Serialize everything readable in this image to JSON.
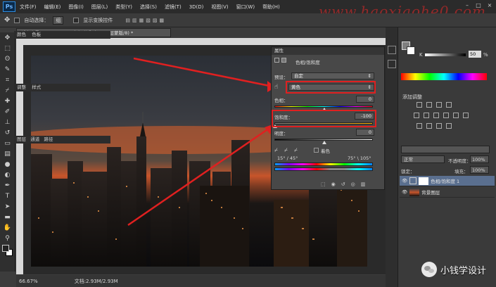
{
  "menubar": {
    "logo": "Ps",
    "items": [
      "文件(F)",
      "编辑(E)",
      "图像(I)",
      "图层(L)",
      "类型(Y)",
      "选择(S)",
      "滤镜(T)",
      "3D(D)",
      "视图(V)",
      "窗口(W)",
      "帮助(H)"
    ],
    "window_controls": [
      "–",
      "□",
      "×"
    ]
  },
  "options_bar": {
    "auto_select_label": "自动选择：",
    "auto_select_value": "组",
    "show_transform_label": "显示变换控件"
  },
  "watermark_top": "www.haoxiaohe0.com",
  "document": {
    "tab_title": "城市夜景.jpg @ 66.7% (色相/饱和度 1, 图层蒙版/8) *"
  },
  "status": {
    "zoom": "66.67%",
    "doc_size": "文档:2.93M/2.93M"
  },
  "properties": {
    "panel_title": "属性",
    "panel_subtitle": "色相/饱和度",
    "preset_label": "预设：",
    "preset_value": "自定",
    "channel_value": "黄色",
    "hue_label": "色相：",
    "hue_value": "0",
    "saturation_label": "饱和度：",
    "saturation_value": "-100",
    "lightness_label": "明度：",
    "lightness_value": "0",
    "colorize_label": "着色",
    "range_left": "15° / 45°",
    "range_right": "75° \\ 105°"
  },
  "color_panel": {
    "tabs": [
      "颜色",
      "色板"
    ],
    "slider_label": "K",
    "slider_value": "50",
    "slider_unit": "%"
  },
  "adjustments_panel": {
    "tabs": [
      "调整",
      "样式"
    ],
    "title": "添加调整"
  },
  "layers_panel": {
    "tabs": [
      "图层",
      "通道",
      "路径"
    ],
    "blend_mode": "正常",
    "opacity_label": "不透明度：",
    "opacity_value": "100%",
    "lock_label": "锁定：",
    "fill_label": "填充：",
    "fill_value": "100%",
    "layers": [
      {
        "name": "色相/饱和度 1"
      },
      {
        "name": "背景图层"
      }
    ]
  },
  "wechat_watermark": "小钱学设计",
  "colors": {
    "highlight": "#e02020",
    "arrow": "#e02020",
    "watermark": "#e82828"
  }
}
